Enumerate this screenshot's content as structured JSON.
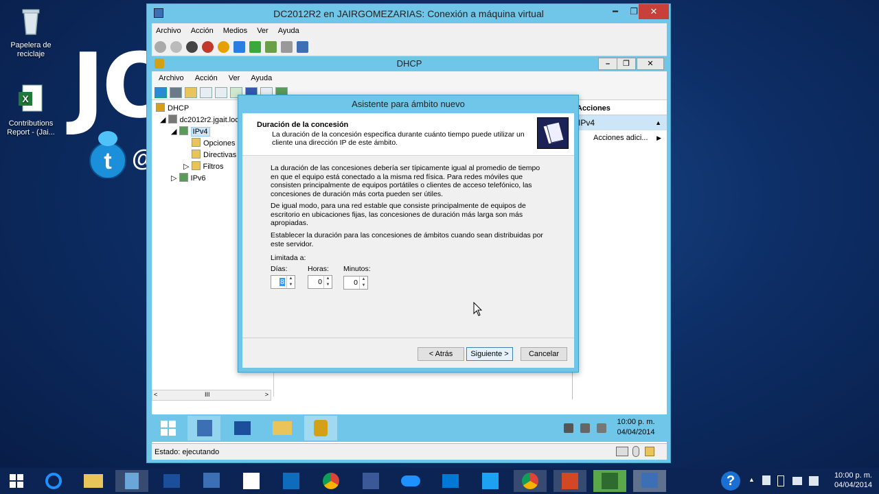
{
  "desktop": {
    "recycle_label": "Papelera de reciclaje",
    "excel_label": "Contributions Report - (Jai...",
    "bg_text": "JO",
    "at_text": "@"
  },
  "vm": {
    "title": "DC2012R2 en JAIRGOMEZARIAS: Conexión a máquina virtual",
    "menu": [
      "Archivo",
      "Acción",
      "Medios",
      "Ver",
      "Ayuda"
    ],
    "minimize": "━",
    "restore": "❐",
    "close": "✕"
  },
  "dhcp": {
    "title": "DHCP",
    "menu": [
      "Archivo",
      "Acción",
      "Ver",
      "Ayuda"
    ],
    "tree": {
      "root": "DHCP",
      "server": "dc2012r2.jgait.loc",
      "ipv4": "IPv4",
      "opciones": "Opciones",
      "directivas": "Directivas",
      "filtros": "Filtros",
      "ipv6": "IPv6"
    },
    "actions_header": "Acciones",
    "actions_selected": "IPv4",
    "actions_item": "Acciones adici...",
    "status": "Estado: ejecutando",
    "scroll_grip": "III"
  },
  "wizard": {
    "title": "Asistente para ámbito nuevo",
    "heading": "Duración de la concesión",
    "subheading": "La duración de la concesión especifica durante cuánto tiempo puede utilizar un cliente una dirección IP de este ámbito.",
    "para1": "La duración de las concesiones debería ser típicamente igual al promedio de tiempo en que el equipo está conectado a la misma red física. Para redes móviles que consisten principalmente de equipos portátiles o clientes de acceso telefónico, las concesiones de duración más corta pueden ser útiles.",
    "para2": "De igual modo, para una red estable que consiste principalmente de equipos de escritorio en ubicaciones fijas, las concesiones de duración más larga son más apropiadas.",
    "para3": "Establecer la duración para las concesiones de ámbitos cuando sean distribuidas por este servidor.",
    "limit_label": "Limitada a:",
    "days_label": "Días:",
    "hours_label": "Horas:",
    "minutes_label": "Minutos:",
    "days_value": "8",
    "hours_value": "0",
    "minutes_value": "0",
    "back_button": "< Atrás",
    "next_button": "Siguiente >",
    "cancel_button": "Cancelar"
  },
  "guest_clock": {
    "time": "10:00 p. m.",
    "date": "04/04/2014"
  },
  "host_clock": {
    "time": "10:00 p. m.",
    "date": "04/04/2014"
  },
  "colors": {
    "accent": "#6fc6e8",
    "host_taskbar": "#0c2454"
  }
}
